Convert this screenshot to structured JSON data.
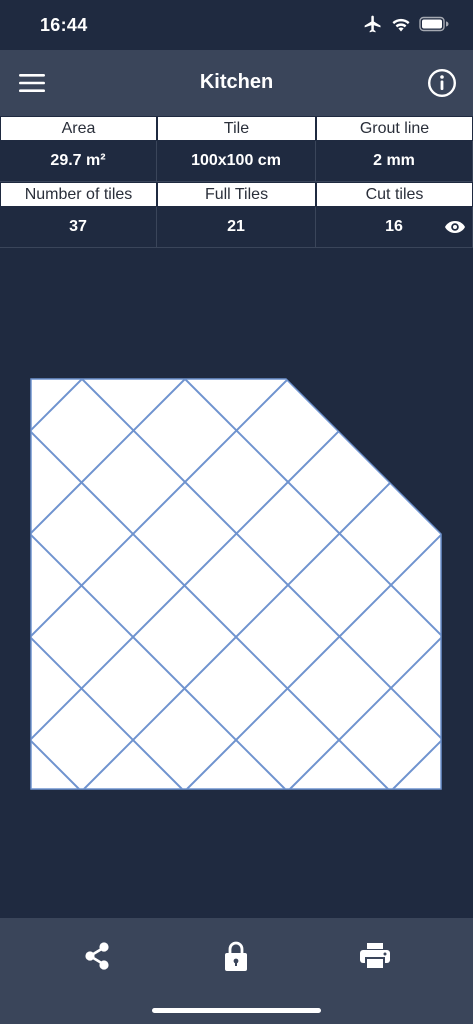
{
  "status": {
    "time": "16:44",
    "icons": [
      "airplane-icon",
      "wifi-icon",
      "battery-icon"
    ]
  },
  "header": {
    "title": "Kitchen",
    "left_icon": "hamburger-menu-icon",
    "right_icon": "info-icon"
  },
  "stats": {
    "row1": [
      {
        "label": "Area",
        "value": "29.7 m²"
      },
      {
        "label": "Tile",
        "value": "100x100 cm"
      },
      {
        "label": "Grout line",
        "value": "2 mm"
      }
    ],
    "row2": [
      {
        "label": "Number of tiles",
        "value": "37"
      },
      {
        "label": "Full Tiles",
        "value": "21"
      },
      {
        "label": "Cut tiles",
        "value": "16"
      }
    ]
  },
  "toolbar": {
    "icons": [
      "share-icon",
      "lock-icon",
      "print-icon"
    ]
  },
  "colors": {
    "background": "#1f2a40",
    "bar": "#3a455a",
    "tile_line": "#6f93cf",
    "tile_fill": "#ffffff"
  }
}
